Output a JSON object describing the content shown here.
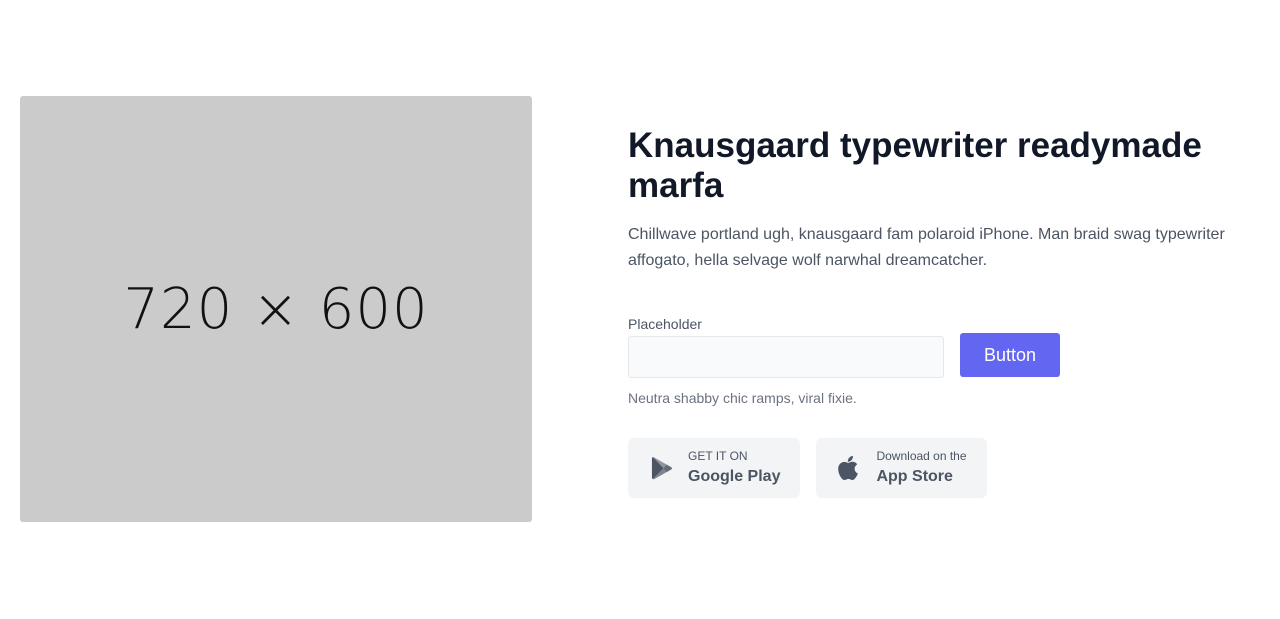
{
  "hero": {
    "image_label": "720 × 600"
  },
  "content": {
    "title": "Knausgaard typewriter readymade marfa",
    "description": "Chillwave portland ugh, knausgaard fam polaroid iPhone. Man braid swag typewriter affogato, hella selvage wolf narwhal dreamcatcher."
  },
  "form": {
    "label": "Placeholder",
    "input_value": "",
    "button_label": "Button",
    "helper": "Neutra shabby chic ramps, viral fixie."
  },
  "stores": {
    "google": {
      "icon": "google-play-icon",
      "small": "GET IT ON",
      "big": "Google Play"
    },
    "apple": {
      "icon": "apple-icon",
      "small": "Download on the",
      "big": "App Store"
    }
  },
  "colors": {
    "accent": "#6366f1",
    "image_placeholder": "#cbcbcb",
    "store_bg": "#f3f4f6",
    "title": "#111827",
    "body_text": "#4b5563"
  }
}
